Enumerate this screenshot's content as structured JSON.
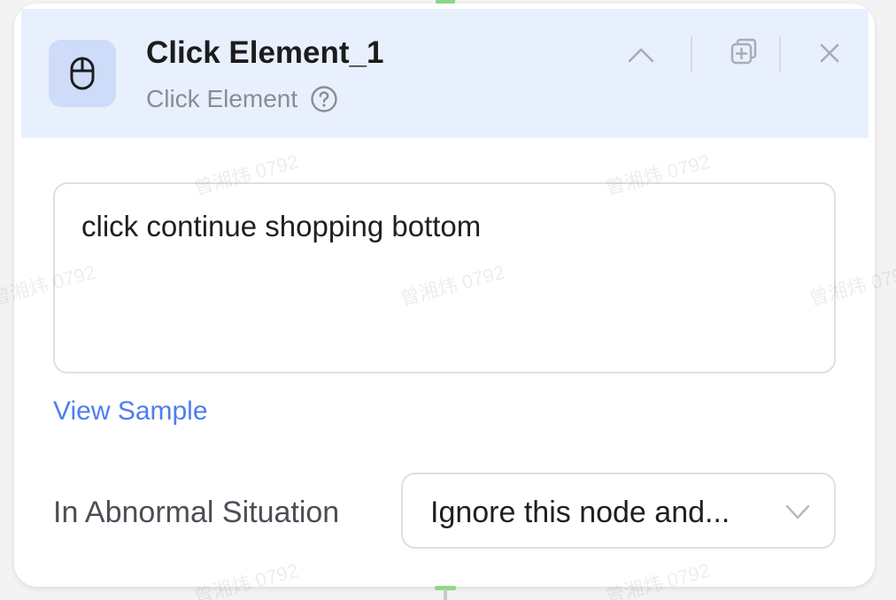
{
  "node": {
    "title": "Click Element_1",
    "type_label": "Click Element",
    "icon": "mouse-icon"
  },
  "header_actions": {
    "collapse_icon": "chevron-up-icon",
    "duplicate_icon": "duplicate-icon",
    "close_icon": "close-icon"
  },
  "description": {
    "value": "click continue shopping bottom"
  },
  "view_sample_label": "View Sample",
  "abnormal": {
    "label": "In Abnormal Situation",
    "selected": "Ignore this node and..."
  },
  "watermark": "曾湘炜 0792",
  "colors": {
    "header_bg": "#e8f0fd",
    "icon_bg": "#cfdcf9",
    "link": "#4d7ef0",
    "connector": "#8fd88a"
  }
}
